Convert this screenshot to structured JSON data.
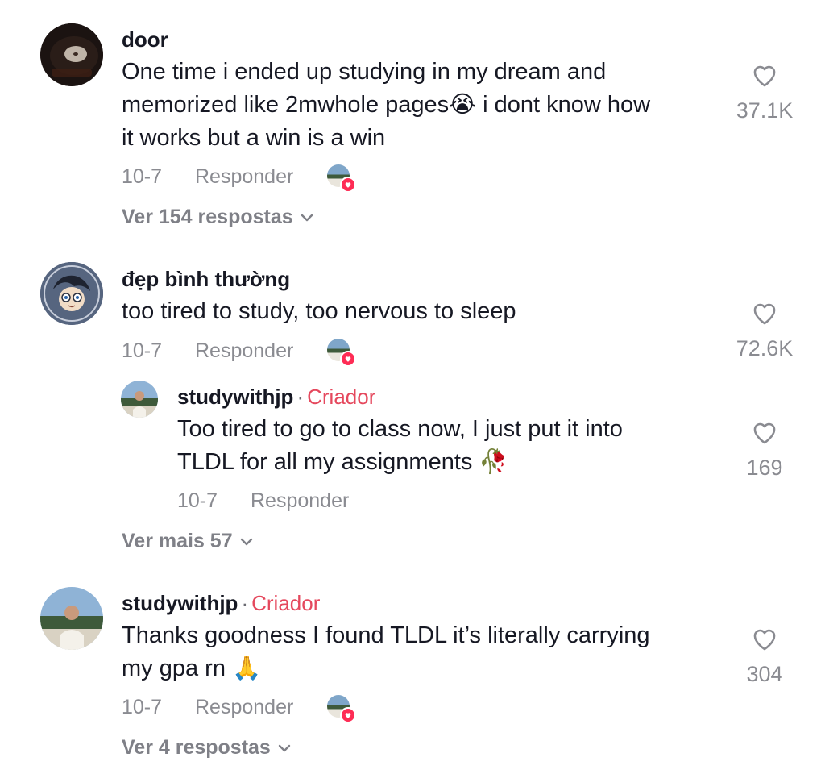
{
  "comments": [
    {
      "username": "door",
      "text_lines": [
        "One time i ended up studying in my dream and",
        "memorized like 2mwhole pages😭 i dont know how",
        "it works but a win is a win"
      ],
      "date": "10-7",
      "reply_label": "Responder",
      "likes": "37.1K",
      "view_replies": "Ver 154 respostas",
      "avatar_icon": "vinyl-record-avatar"
    },
    {
      "username": "đẹp bình thường",
      "text_lines": [
        "too tired to study, too nervous to sleep"
      ],
      "date": "10-7",
      "reply_label": "Responder",
      "likes": "72.6K",
      "avatar_icon": "anime-character-avatar",
      "reply": {
        "username": "studywithjp",
        "separator": "·",
        "badge": "Criador",
        "text_lines": [
          "Too tired to go to class now, I just put it into",
          "TLDL for all my assignments 🥀"
        ],
        "date": "10-7",
        "reply_label": "Responder",
        "likes": "169"
      },
      "view_more": "Ver mais 57"
    },
    {
      "username": "studywithjp",
      "separator": "·",
      "badge": "Criador",
      "text_lines": [
        "Thanks goodness I found TLDL it’s literally carrying",
        "my gpa rn 🙏"
      ],
      "date": "10-7",
      "reply_label": "Responder",
      "likes": "304",
      "view_replies": "Ver 4 respostas"
    }
  ],
  "colors": {
    "creator_badge": "#e5485d",
    "muted_text": "#8a8b91",
    "liked_badge": "#fe2c55",
    "primary_text": "#161823"
  }
}
